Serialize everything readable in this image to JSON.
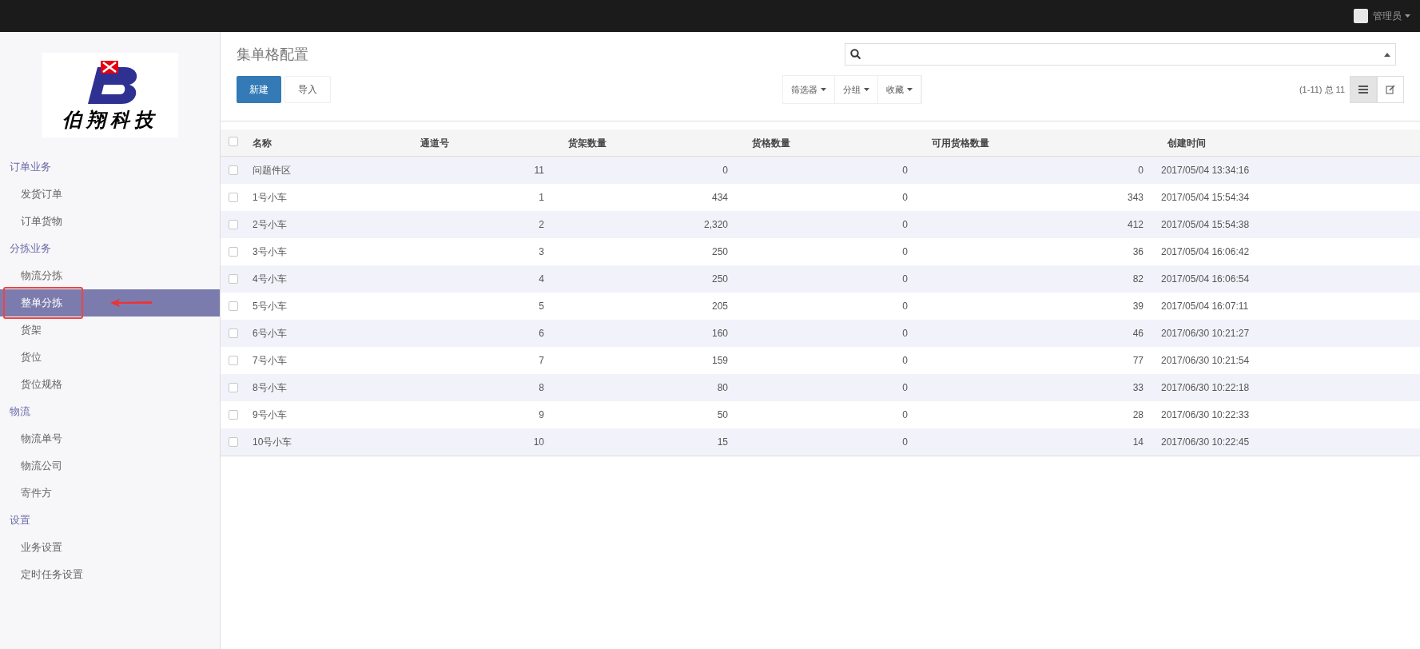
{
  "top_bar": {
    "user": "管理员"
  },
  "sidebar": {
    "logo_text": "伯翔科技",
    "groups": [
      {
        "title": "订单业务",
        "items": [
          {
            "label": "发货订单",
            "selected": false
          },
          {
            "label": "订单货物",
            "selected": false
          }
        ]
      },
      {
        "title": "分拣业务",
        "items": [
          {
            "label": "物流分拣",
            "selected": false
          },
          {
            "label": "整单分拣",
            "selected": true
          },
          {
            "label": "货架",
            "selected": false
          },
          {
            "label": "货位",
            "selected": false
          },
          {
            "label": "货位规格",
            "selected": false
          }
        ]
      },
      {
        "title": "物流",
        "items": [
          {
            "label": "物流单号",
            "selected": false
          },
          {
            "label": "物流公司",
            "selected": false
          },
          {
            "label": "寄件方",
            "selected": false
          }
        ]
      },
      {
        "title": "设置",
        "items": [
          {
            "label": "业务设置",
            "selected": false
          },
          {
            "label": "定时任务设置",
            "selected": false
          }
        ]
      }
    ]
  },
  "page": {
    "title": "集单格配置",
    "buttons": [
      "新建",
      "导入"
    ],
    "filters": [
      "筛选器",
      "分组",
      "收藏"
    ],
    "pager": "(1-11) 总 11",
    "view_toggle": [
      {
        "kind": "list",
        "selected": true
      },
      {
        "kind": "form",
        "selected": false
      }
    ]
  },
  "table": {
    "select_all_checked": false,
    "columns": [
      "名称",
      "通道号",
      "货架数量",
      "货格数量",
      "可用货格数量",
      "创建时间"
    ],
    "rows": [
      {
        "checked": false,
        "cells": [
          "问题件区",
          "11",
          "0",
          "0",
          "0",
          "2017/05/04 13:34:16"
        ]
      },
      {
        "checked": false,
        "cells": [
          "1号小车",
          "1",
          "434",
          "0",
          "343",
          "2017/05/04 15:54:34"
        ]
      },
      {
        "checked": false,
        "cells": [
          "2号小车",
          "2",
          "2,320",
          "0",
          "412",
          "2017/05/04 15:54:38"
        ]
      },
      {
        "checked": false,
        "cells": [
          "3号小车",
          "3",
          "250",
          "0",
          "36",
          "2017/05/04 16:06:42"
        ]
      },
      {
        "checked": false,
        "cells": [
          "4号小车",
          "4",
          "250",
          "0",
          "82",
          "2017/05/04 16:06:54"
        ]
      },
      {
        "checked": false,
        "cells": [
          "5号小车",
          "5",
          "205",
          "0",
          "39",
          "2017/05/04 16:07:11"
        ]
      },
      {
        "checked": false,
        "cells": [
          "6号小车",
          "6",
          "160",
          "0",
          "46",
          "2017/06/30 10:21:27"
        ]
      },
      {
        "checked": false,
        "cells": [
          "7号小车",
          "7",
          "159",
          "0",
          "77",
          "2017/06/30 10:21:54"
        ]
      },
      {
        "checked": false,
        "cells": [
          "8号小车",
          "8",
          "80",
          "0",
          "33",
          "2017/06/30 10:22:18"
        ]
      },
      {
        "checked": false,
        "cells": [
          "9号小车",
          "9",
          "50",
          "0",
          "28",
          "2017/06/30 10:22:33"
        ]
      },
      {
        "checked": false,
        "cells": [
          "10号小车",
          "10",
          "15",
          "0",
          "14",
          "2017/06/30 10:22:45"
        ]
      }
    ]
  }
}
